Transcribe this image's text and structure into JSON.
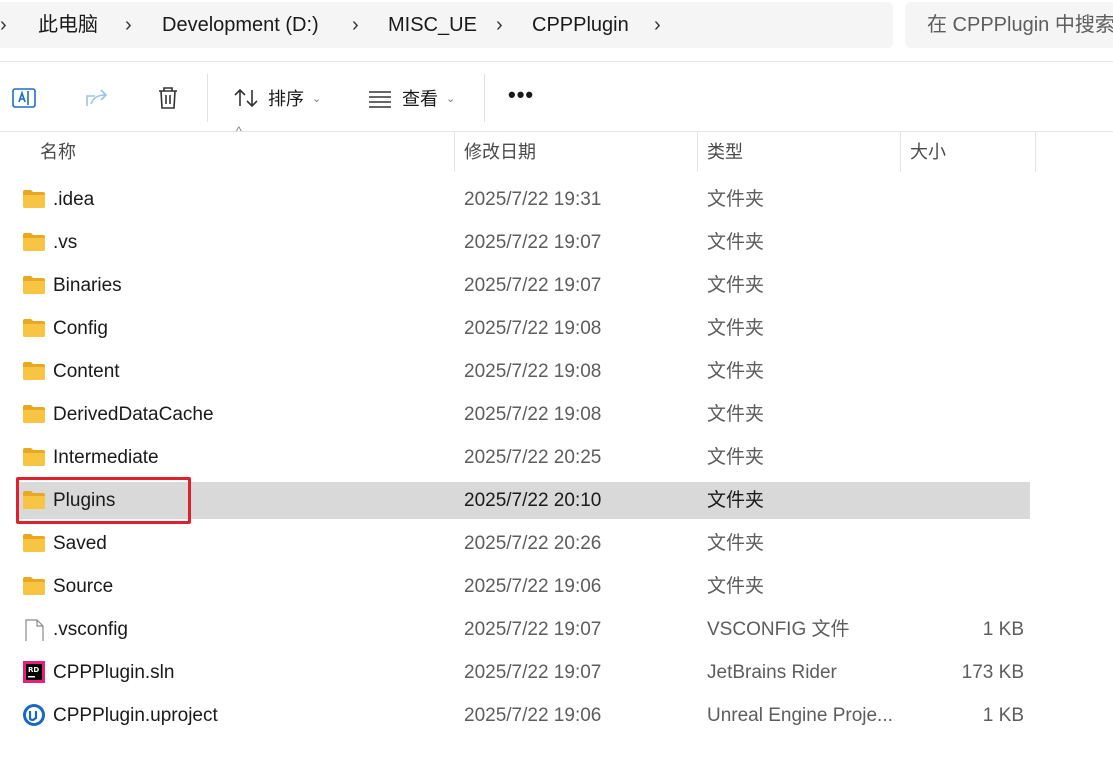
{
  "breadcrumb": {
    "items": [
      "此电脑",
      "Development (D:)",
      "MISC_UE",
      "CPPPlugin"
    ]
  },
  "search": {
    "placeholder": "在 CPPPlugin 中搜索"
  },
  "toolbar": {
    "sort_label": "排序",
    "view_label": "查看",
    "more_label": "•••"
  },
  "columns": {
    "name": "名称",
    "date": "修改日期",
    "type": "类型",
    "size": "大小"
  },
  "files": [
    {
      "name": ".idea",
      "date": "2025/7/22 19:31",
      "type": "文件夹",
      "size": "",
      "icon": "folder-icon"
    },
    {
      "name": ".vs",
      "date": "2025/7/22 19:07",
      "type": "文件夹",
      "size": "",
      "icon": "folder-icon"
    },
    {
      "name": "Binaries",
      "date": "2025/7/22 19:07",
      "type": "文件夹",
      "size": "",
      "icon": "folder-icon"
    },
    {
      "name": "Config",
      "date": "2025/7/22 19:08",
      "type": "文件夹",
      "size": "",
      "icon": "folder-icon"
    },
    {
      "name": "Content",
      "date": "2025/7/22 19:08",
      "type": "文件夹",
      "size": "",
      "icon": "folder-icon"
    },
    {
      "name": "DerivedDataCache",
      "date": "2025/7/22 19:08",
      "type": "文件夹",
      "size": "",
      "icon": "folder-icon"
    },
    {
      "name": "Intermediate",
      "date": "2025/7/22 20:25",
      "type": "文件夹",
      "size": "",
      "icon": "folder-icon"
    },
    {
      "name": "Plugins",
      "date": "2025/7/22 20:10",
      "type": "文件夹",
      "size": "",
      "icon": "folder-icon"
    },
    {
      "name": "Saved",
      "date": "2025/7/22 20:26",
      "type": "文件夹",
      "size": "",
      "icon": "folder-icon"
    },
    {
      "name": "Source",
      "date": "2025/7/22 19:06",
      "type": "文件夹",
      "size": "",
      "icon": "folder-icon"
    },
    {
      "name": ".vsconfig",
      "date": "2025/7/22 19:07",
      "type": "VSCONFIG 文件",
      "size": "1 KB",
      "icon": "file-icon"
    },
    {
      "name": "CPPPlugin.sln",
      "date": "2025/7/22 19:07",
      "type": "JetBrains Rider",
      "size": "173 KB",
      "icon": "rider-icon"
    },
    {
      "name": "CPPPlugin.uproject",
      "date": "2025/7/22 19:06",
      "type": "Unreal Engine Proje...",
      "size": "1 KB",
      "icon": "unreal-icon"
    }
  ],
  "selected_file": "Plugins",
  "colors": {
    "selected_row": "#d9d9d9",
    "highlight": "#e0202c",
    "folder": "#f8c443"
  }
}
